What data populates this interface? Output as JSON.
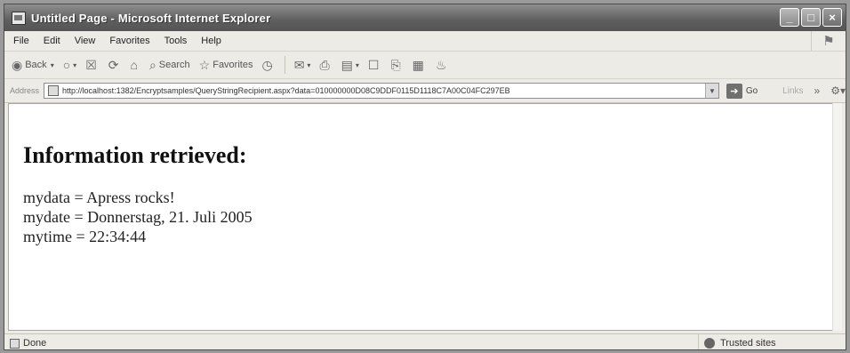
{
  "window": {
    "title": "Untitled Page - Microsoft Internet Explorer",
    "controls": {
      "minimize": "_",
      "maximize": "□",
      "close": "×"
    }
  },
  "menu": [
    "File",
    "Edit",
    "View",
    "Favorites",
    "Tools",
    "Help"
  ],
  "toolbar": {
    "back_label": "Back",
    "search_label": "Search",
    "favorites_label": "Favorites"
  },
  "address": {
    "label": "Address",
    "url": "http://localhost:1382/Encryptsamples/QueryStringRecipient.aspx?data=010000000D08C9DDF0115D1118C7A00C04FC297EB",
    "go_label": "Go",
    "links_label": "Links"
  },
  "page": {
    "heading": "Information retrieved:",
    "lines": [
      "mydata = Apress rocks!",
      "mydate = Donnerstag, 21. Juli 2005",
      "mytime = 22:34:44"
    ]
  },
  "status": {
    "text": "Done",
    "zone": "Trusted sites"
  },
  "icons": {
    "back": "back-arrow-icon",
    "forward": "forward-arrow-icon",
    "stop": "stop-icon",
    "refresh": "refresh-icon",
    "home": "home-icon",
    "search": "search-icon",
    "favorites": "star-icon",
    "history": "history-icon",
    "mail": "mail-icon",
    "print": "print-icon"
  }
}
